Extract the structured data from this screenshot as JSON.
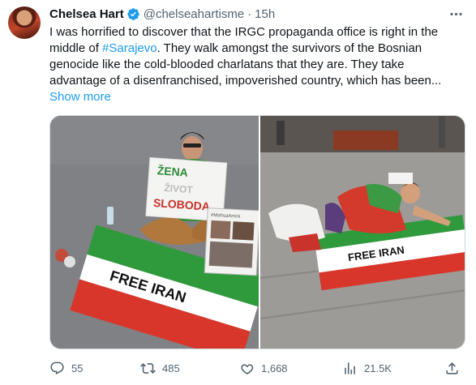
{
  "author": {
    "name": "Chelsea Hart",
    "handle": "@chelseahartisme",
    "time": "15h",
    "separator": "·"
  },
  "tweet": {
    "text_before": "I was horrified to discover that the IRGC propaganda office is right in the middle of ",
    "hashtag": "#Sarajevo",
    "text_after": ". They walk amongst the survivors of the Bosnian genocide like the cold-blooded charlatans that they are. They take advantage of a disenfranchised, impoverished country, which has been...",
    "show_more": "Show more"
  },
  "media": {
    "left": {
      "sign_lines": [
        "ŽENA",
        "ŽIVOT",
        "SLOBODA"
      ],
      "flag_text": "FREE IRAN",
      "poster_text": "#MahsaAmini"
    },
    "right": {
      "flag_text": "FREE IRAN"
    }
  },
  "actions": {
    "replies": "55",
    "retweets": "485",
    "likes": "1,668",
    "views": "21.5K"
  },
  "colors": {
    "accent": "#1d9bf0",
    "muted": "#536471",
    "flag_green": "#2f9a3c",
    "flag_red": "#d9362b"
  }
}
